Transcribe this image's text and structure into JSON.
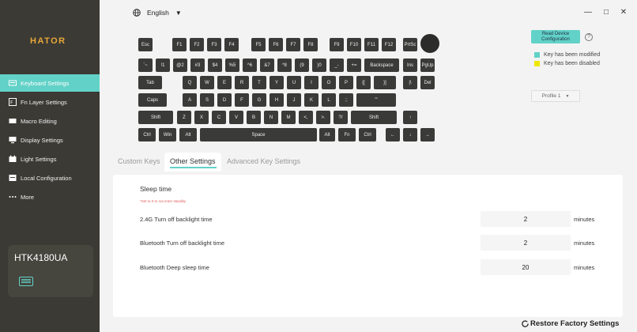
{
  "app": {
    "logo": "HATOR",
    "accent_color": "#62d2c8"
  },
  "topbar": {
    "language": "English"
  },
  "sidebar": {
    "items": [
      {
        "label": "Keyboard Settings",
        "icon": "keyboard-icon"
      },
      {
        "label": "Fn Layer Settings",
        "icon": "fn-layer-icon"
      },
      {
        "label": "Macro Editing",
        "icon": "macro-icon"
      },
      {
        "label": "Display Settings",
        "icon": "display-icon"
      },
      {
        "label": "Light Settings",
        "icon": "light-icon"
      },
      {
        "label": "Local Configuration",
        "icon": "local-config-icon"
      },
      {
        "label": "More",
        "icon": "more-icon"
      }
    ],
    "device_name": "HTK4180UA"
  },
  "keyboard": {
    "rows": [
      [
        "Esc",
        "F1",
        "F2",
        "F3",
        "F4",
        "F5",
        "F6",
        "F7",
        "F8",
        "F9",
        "F10",
        "F11",
        "F12",
        "PrtSc"
      ],
      [
        "`~",
        "!1",
        "@2",
        "#3",
        "$4",
        "%5",
        "^6",
        "&7",
        "*8",
        "(9",
        ")0",
        "_-",
        "+=",
        "Backspace",
        "Ins",
        "PgUp"
      ],
      [
        "Tab",
        "Q",
        "W",
        "E",
        "R",
        "T",
        "Y",
        "U",
        "I",
        "O",
        "P",
        "{[",
        "}]",
        "|\\",
        "Del",
        "PgDn"
      ],
      [
        "Caps",
        "A",
        "S",
        "D",
        "F",
        "G",
        "H",
        "J",
        "K",
        "L",
        ":;",
        "\"'",
        "Enter"
      ],
      [
        "Shift",
        "Z",
        "X",
        "C",
        "V",
        "B",
        "N",
        "M",
        "<,",
        ">.",
        "?/",
        "Shift",
        "↑"
      ],
      [
        "Ctrl",
        "Win",
        "Alt",
        "Space",
        "Alt",
        "Fn",
        "Ctrl",
        "←",
        "↓",
        "→"
      ]
    ]
  },
  "panel": {
    "read_button_line1": "Read Device",
    "read_button_line2": "Configuration",
    "help": "?",
    "legend": [
      {
        "label": "Key has been modified",
        "color": "#62d2c8"
      },
      {
        "label": "Key has been disabled",
        "color": "#f0e800"
      }
    ],
    "profile": "Profile 1"
  },
  "tabs": [
    "Custom Keys",
    "Other Settings",
    "Advanced Key Settings"
  ],
  "sleep": {
    "title": "Sleep time",
    "note": "*Set to 0 to not enter standby",
    "rows": [
      {
        "label": "2.4G Turn off backlight time",
        "value": "2",
        "unit": "minutes"
      },
      {
        "label": "Bluetooth Turn off backlight time",
        "value": "2",
        "unit": "minutes"
      },
      {
        "label": "Bluetooth Deep sleep time",
        "value": "20",
        "unit": "minutes"
      }
    ]
  },
  "restore_label": "Restore Factory Settings"
}
